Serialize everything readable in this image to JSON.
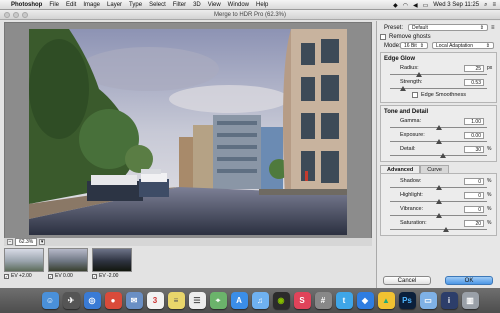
{
  "menubar": {
    "app_name": "Photoshop",
    "items": [
      "File",
      "Edit",
      "Image",
      "Layer",
      "Type",
      "Select",
      "Filter",
      "3D",
      "View",
      "Window",
      "Help"
    ],
    "clock": "Wed 3 Sep  11:25"
  },
  "window": {
    "title": "Merge to HDR Pro (62.3%)"
  },
  "preview": {
    "zoom_value": "62.3%"
  },
  "thumbnails": [
    {
      "label": "EV +2.00",
      "checked": true
    },
    {
      "label": "EV 0.00",
      "checked": true
    },
    {
      "label": "EV -2.00",
      "checked": true
    }
  ],
  "panel": {
    "preset_label": "Preset:",
    "preset_value": "Default",
    "remove_ghosts_label": "Remove ghosts",
    "mode_label": "Mode:",
    "bit_depth": "16 Bit",
    "method": "Local Adaptation",
    "edge_glow": {
      "heading": "Edge Glow",
      "radius_label": "Radius:",
      "radius_value": "25",
      "radius_unit": "px",
      "radius_frac": 0.3,
      "strength_label": "Strength:",
      "strength_value": "0.53",
      "strength_frac": 0.13,
      "smoothness_label": "Edge Smoothness"
    },
    "tone_detail": {
      "heading": "Tone and Detail",
      "gamma_label": "Gamma:",
      "gamma_value": "1.00",
      "gamma_frac": 0.5,
      "exposure_label": "Exposure:",
      "exposure_value": "0.00",
      "exposure_frac": 0.5,
      "detail_label": "Detail:",
      "detail_value": "30",
      "detail_unit": "%",
      "detail_frac": 0.55
    },
    "tabs": {
      "advanced": "Advanced",
      "curve": "Curve"
    },
    "advanced": {
      "shadow_label": "Shadow:",
      "shadow_value": "0",
      "shadow_frac": 0.5,
      "highlight_label": "Highlight:",
      "highlight_value": "0",
      "highlight_frac": 0.5,
      "vibrance_label": "Vibrance:",
      "vibrance_value": "0",
      "vibrance_frac": 0.5,
      "saturation_label": "Saturation:",
      "saturation_value": "20",
      "saturation_frac": 0.58,
      "unit": "%"
    },
    "cancel_label": "Cancel",
    "ok_label": "OK"
  },
  "dock": {
    "icons": [
      "finder-icon",
      "launchpad-icon",
      "safari-icon",
      "chrome-icon",
      "mail-icon",
      "calendar-icon",
      "notes-icon",
      "reminders-icon",
      "maps-icon",
      "appstore-icon",
      "itunes-icon",
      "spotify-icon",
      "skitch-icon",
      "calculator-icon",
      "twitter-icon",
      "dropbox-icon",
      "drive-icon",
      "photoshop-icon",
      "folder-icon",
      "info-icon",
      "trash-icon"
    ]
  }
}
